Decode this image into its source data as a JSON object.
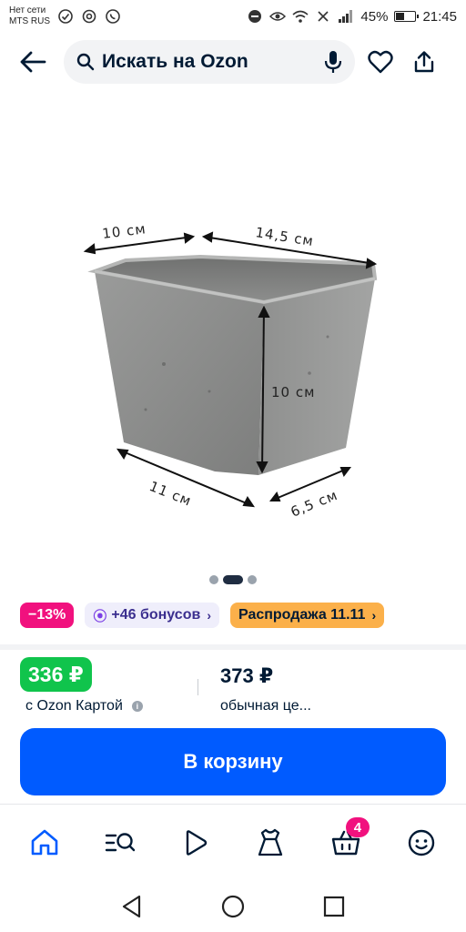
{
  "status_bar": {
    "carrier_line1": "Нет сети",
    "carrier_line2": "MTS RUS",
    "battery_percent": "45%",
    "battery_level": 0.45,
    "time": "21:45"
  },
  "header": {
    "search_placeholder": "Искать на Ozon",
    "icons": [
      "back-arrow-icon",
      "search-icon",
      "microphone-icon",
      "heart-icon",
      "share-icon"
    ]
  },
  "product_image": {
    "dimensions": {
      "top_width": "10 см",
      "top_length": "14,5 см",
      "height": "10 см",
      "bottom_length": "11 см",
      "bottom_width": "6,5 см"
    },
    "carousel": {
      "total": 3,
      "active": 1
    }
  },
  "badges": {
    "discount": "−13%",
    "bonus": "+46 бонусов",
    "sale": "Распродажа 11.11"
  },
  "price": {
    "ozon_card_price": "336 ₽",
    "ozon_card_caption": "с Ozon Картой",
    "regular_price": "373 ₽",
    "regular_caption": "обычная це..."
  },
  "cart_button": {
    "label": "В корзину"
  },
  "bottom_nav": {
    "items": [
      "home-icon",
      "catalog-search-icon",
      "play-icon",
      "fashion-icon",
      "cart-icon",
      "profile-icon"
    ],
    "cart_count": "4"
  },
  "colors": {
    "accent_blue": "#005bff",
    "green_price": "#10c44c",
    "pink": "#f1117e",
    "orange": "#fbb04a",
    "text_dark": "#001a34"
  }
}
